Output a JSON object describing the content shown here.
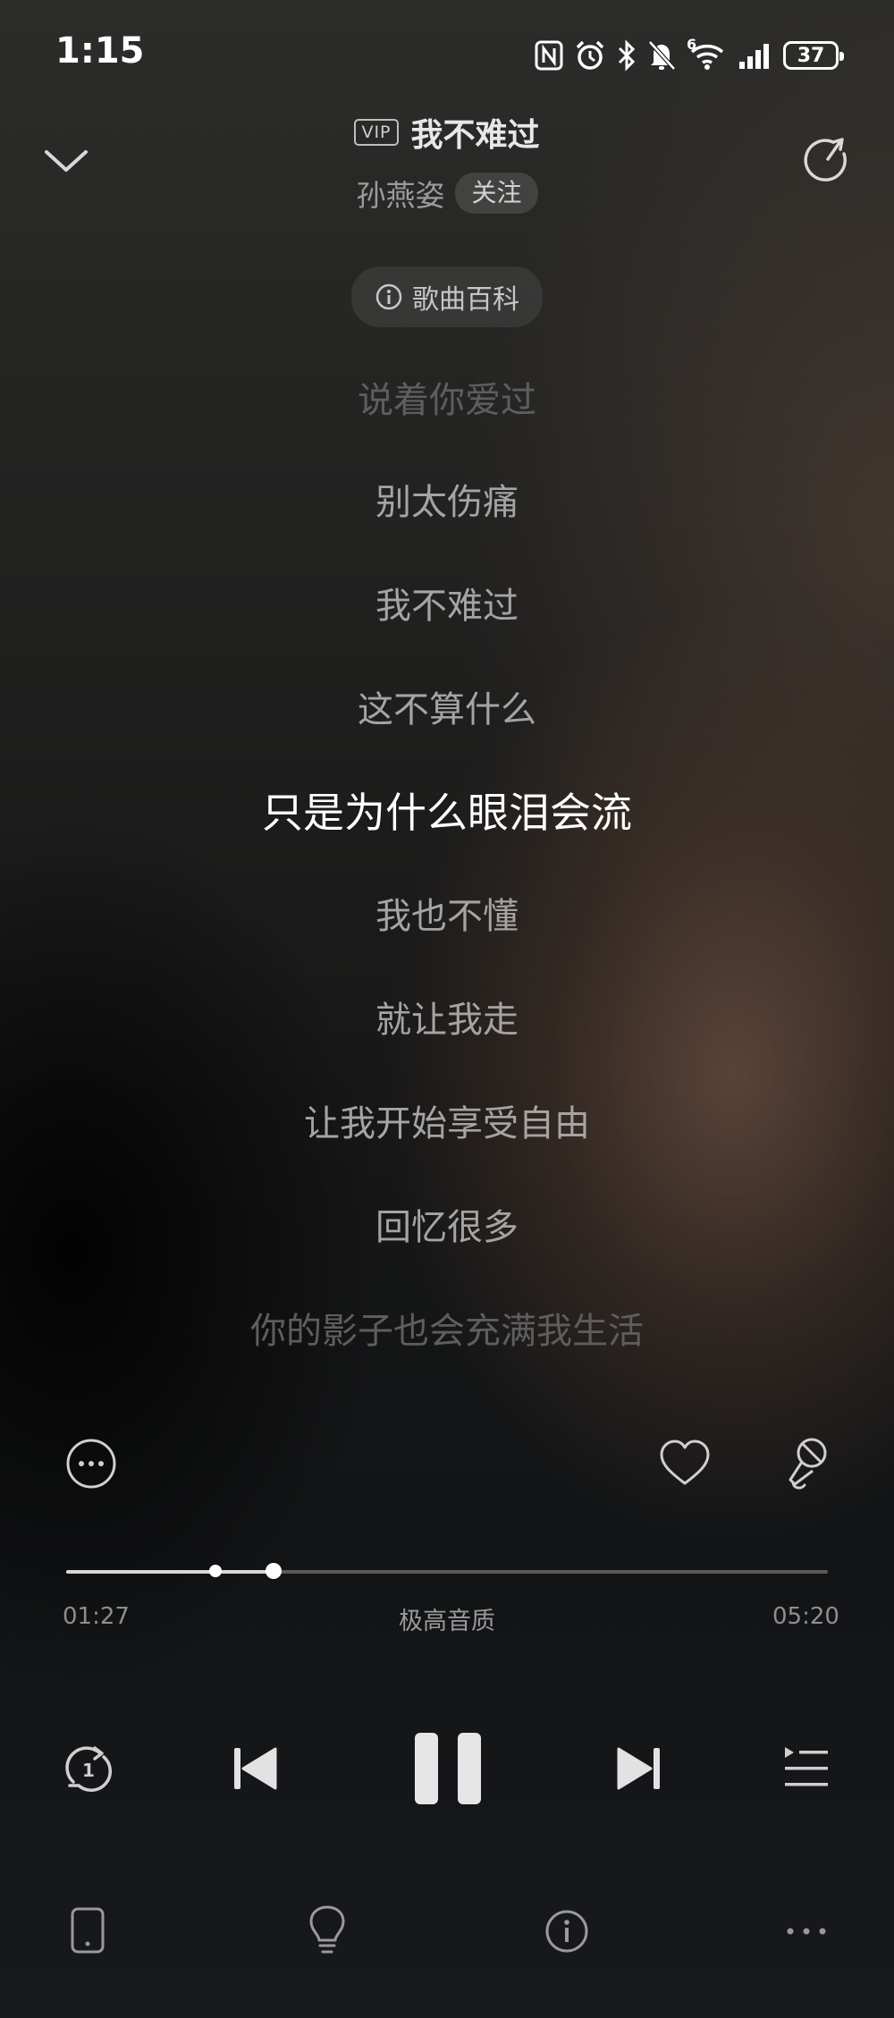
{
  "status_bar": {
    "time": "1:15",
    "battery": "37",
    "network_type": "6",
    "icons": [
      "nfc-icon",
      "alarm-icon",
      "bluetooth-icon",
      "mute-bell-icon",
      "wifi-icon",
      "signal-icon",
      "battery-icon"
    ]
  },
  "header": {
    "vip_label": "VIP",
    "song_title": "我不难过",
    "artist": "孙燕姿",
    "follow_label": "关注",
    "wiki_label": "歌曲百科"
  },
  "lyrics": {
    "lines": [
      "说着你爱过",
      "别太伤痛",
      "我不难过",
      "这不算什么",
      "只是为什么眼泪会流",
      "我也不懂",
      "就让我走",
      "让我开始享受自由",
      "回忆很多",
      "你的影子也会充满我生活"
    ],
    "current_index": 4
  },
  "player": {
    "current_time": "01:27",
    "total_time": "05:20",
    "quality_label": "极高音质",
    "progress_fraction": 0.272,
    "buffer_marker_fraction": 0.196,
    "repeat_badge": "1"
  },
  "colors": {
    "accent": "#ffffff",
    "inactive_lyric": "#a4a4a4",
    "faded_lyric": "#5e5e5e",
    "track": "#595959"
  }
}
